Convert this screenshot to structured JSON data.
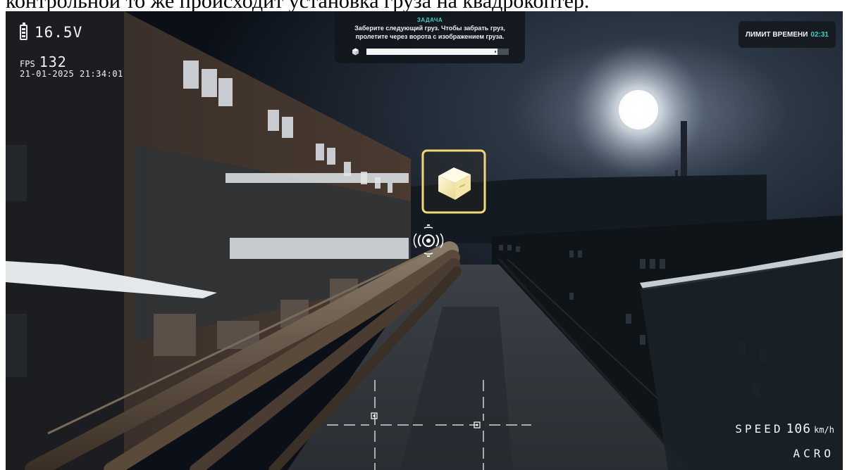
{
  "caption": "контрольной то же происходит установка груза на квадрокоптер.",
  "hud": {
    "voltage": "16.5V",
    "fps_label": "FPS",
    "fps_value": "132",
    "datetime": "21-01-2025 21:34:01",
    "speed_label": "SPEED",
    "speed_value": "106",
    "speed_unit": "km/h",
    "flight_mode": "ACRO"
  },
  "task": {
    "title": "ЗАДАЧА",
    "line1": "Заберите следующий груз. Чтобы забрать груз,",
    "line2": "пролетите через ворота с изображением груза.",
    "progress": 0.92,
    "icon": "box-icon"
  },
  "time_limit": {
    "label": "ЛИМИТ ВРЕМЕНИ",
    "value": "02:31"
  },
  "colors": {
    "accent": "#35d3c6",
    "gate": "#f0d878",
    "hud_text": "#f2f4f6"
  }
}
